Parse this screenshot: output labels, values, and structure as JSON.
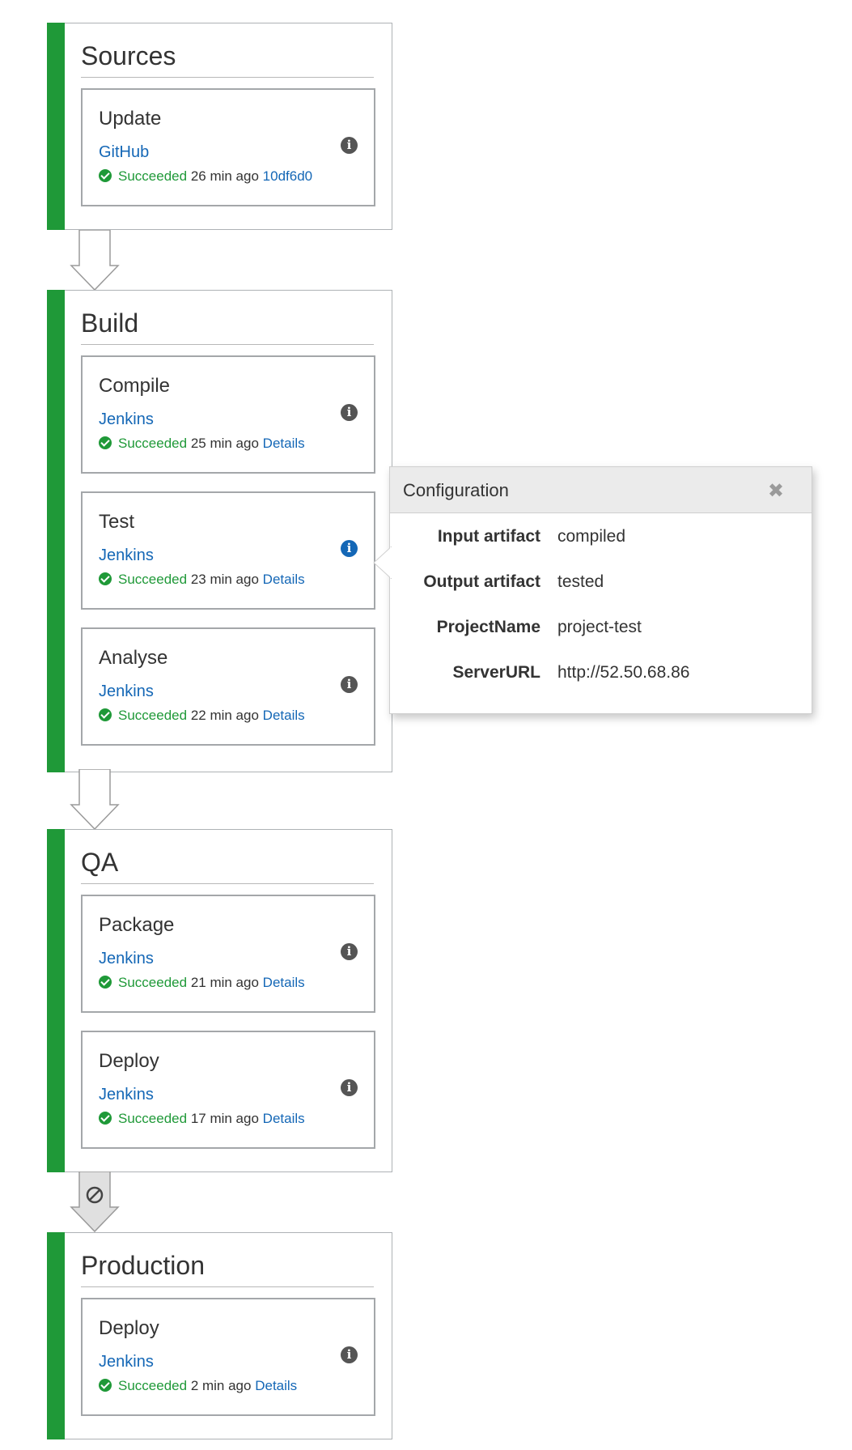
{
  "stages": [
    {
      "name": "Sources",
      "actions": [
        {
          "name": "Update",
          "provider": "GitHub",
          "status": "Succeeded",
          "time": "26 min ago",
          "link": "10df6d0"
        }
      ]
    },
    {
      "name": "Build",
      "actions": [
        {
          "name": "Compile",
          "provider": "Jenkins",
          "status": "Succeeded",
          "time": "25 min ago",
          "link": "Details"
        },
        {
          "name": "Test",
          "provider": "Jenkins",
          "status": "Succeeded",
          "time": "23 min ago",
          "link": "Details"
        },
        {
          "name": "Analyse",
          "provider": "Jenkins",
          "status": "Succeeded",
          "time": "22 min ago",
          "link": "Details"
        }
      ]
    },
    {
      "name": "QA",
      "actions": [
        {
          "name": "Package",
          "provider": "Jenkins",
          "status": "Succeeded",
          "time": "21 min ago",
          "link": "Details"
        },
        {
          "name": "Deploy",
          "provider": "Jenkins",
          "status": "Succeeded",
          "time": "17 min ago",
          "link": "Details"
        }
      ]
    },
    {
      "name": "Production",
      "actions": [
        {
          "name": "Deploy",
          "provider": "Jenkins",
          "status": "Succeeded",
          "time": "2 min ago",
          "link": "Details"
        }
      ]
    }
  ],
  "popover": {
    "title": "Configuration",
    "rows": [
      {
        "key": "Input artifact",
        "value": "compiled"
      },
      {
        "key": "Output artifact",
        "value": "tested"
      },
      {
        "key": "ProjectName",
        "value": "project-test"
      },
      {
        "key": "ServerURL",
        "value": "http://52.50.68.86"
      }
    ]
  },
  "colors": {
    "success": "#1f9938",
    "link": "#1467b6",
    "icon": "#555555",
    "active_icon": "#1467b6",
    "disabled_transition": "#e0e0e0"
  },
  "icons": {
    "status": "check-circle-icon",
    "info": "info-icon",
    "transition": "down-arrow-icon",
    "disabled_transition": "disabled-circle-icon",
    "close": "close-icon"
  }
}
